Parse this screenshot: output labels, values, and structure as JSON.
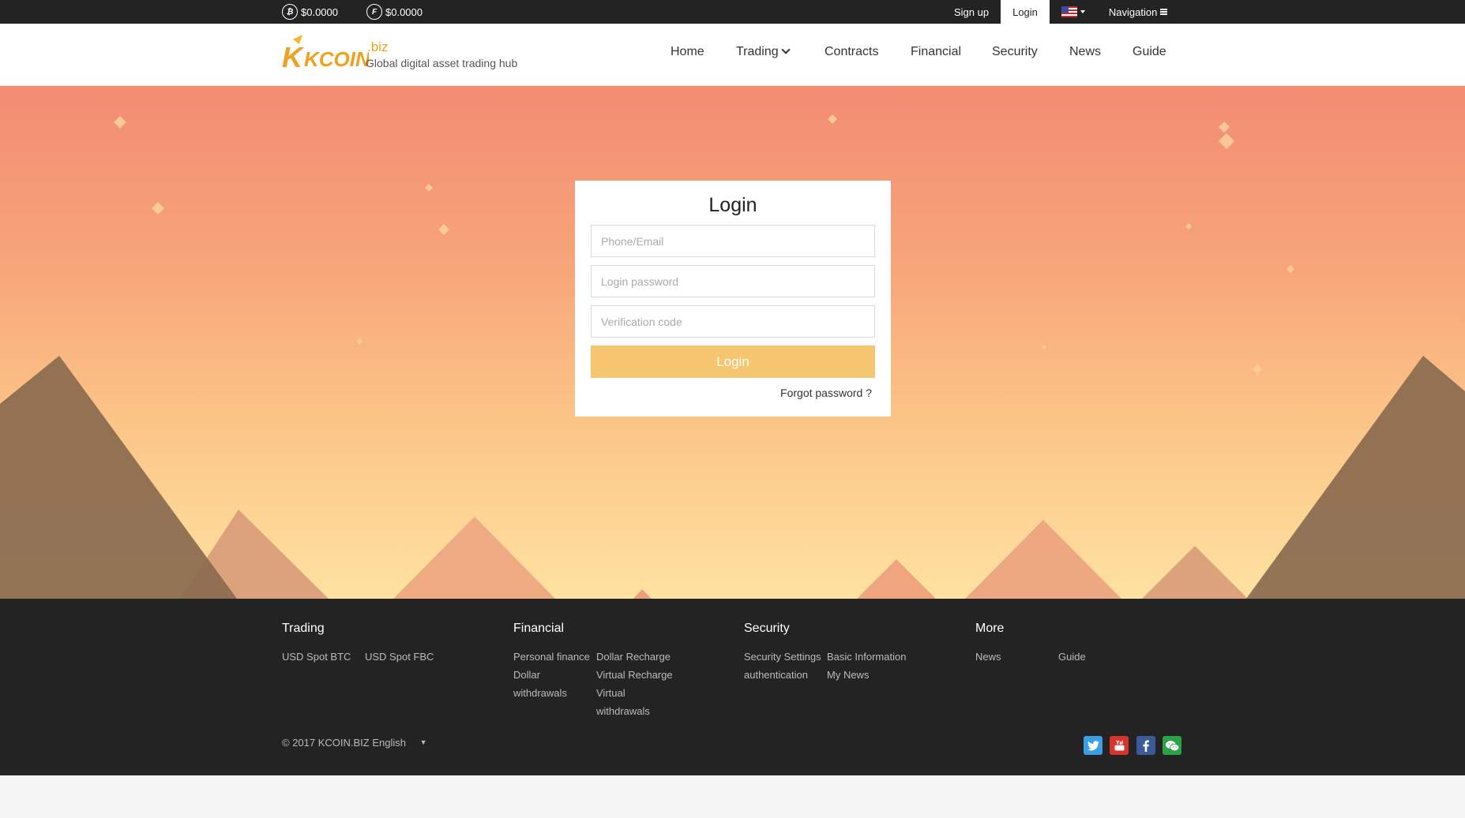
{
  "topbar": {
    "btc_price": "$0.0000",
    "fbc_price": "$0.0000",
    "btc_symbol": "₿",
    "fbc_symbol": "F",
    "signup_label": "Sign up",
    "login_label": "Login",
    "language_flag": "us-flag-icon",
    "navigation_label": "Navigation"
  },
  "header": {
    "logo_text": "KCOIN",
    "logo_suffix": ".biz",
    "tagline": "Global digital asset trading hub",
    "nav": [
      "Home",
      "Trading",
      "Contracts",
      "Financial",
      "Security",
      "News",
      "Guide"
    ]
  },
  "login": {
    "title": "Login",
    "phone_placeholder": "Phone/Email",
    "password_placeholder": "Login password",
    "code_placeholder": "Verification code",
    "submit_label": "Login",
    "forgot_label": "Forgot password ?"
  },
  "footer": {
    "columns": [
      {
        "title": "Trading",
        "links": [
          "USD Spot BTC",
          "USD Spot FBC"
        ]
      },
      {
        "title": "Financial",
        "links": [
          "Personal finance",
          "Dollar Recharge",
          "Dollar",
          "Virtual Recharge",
          "withdrawals",
          "Virtual",
          "withdrawals"
        ]
      },
      {
        "title": "Security",
        "links": [
          "Security Settings",
          "Basic Information",
          "authentication",
          "My News"
        ]
      },
      {
        "title": "More",
        "links": [
          "News",
          "Guide"
        ]
      }
    ],
    "copyright": "© 2017 KCOIN.BIZ English",
    "language_caret": "▼",
    "social": [
      "twitter-icon",
      "youtube-icon",
      "facebook-icon",
      "wechat-icon"
    ]
  },
  "colors": {
    "accent": "#f6c56f",
    "topbar_bg": "#232323",
    "footer_bg": "#232323",
    "twitter": "#3a9ee4",
    "youtube": "#d9342b",
    "facebook": "#3b5a9a",
    "wechat": "#2ba245"
  }
}
